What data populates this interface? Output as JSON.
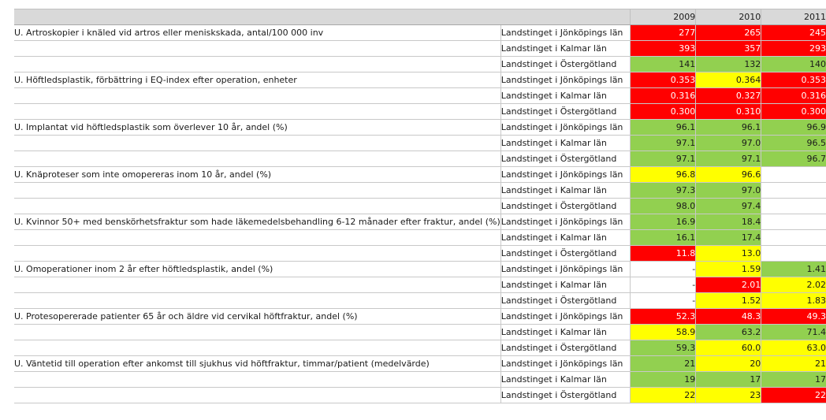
{
  "colors": {
    "red": "#ff0000",
    "yellow": "#ffff00",
    "green": "#92d050",
    "white": "#ffffff"
  },
  "years": [
    "2009",
    "2010",
    "2011"
  ],
  "indicators": [
    {
      "name": "U. Artroskopier i knäled vid artros eller meniskskada, antal/100 000 inv",
      "rows": [
        {
          "region": "Landstinget i Jönköpings län",
          "values": [
            {
              "v": "277",
              "c": "red"
            },
            {
              "v": "265",
              "c": "red"
            },
            {
              "v": "245",
              "c": "red"
            }
          ]
        },
        {
          "region": "Landstinget i Kalmar län",
          "values": [
            {
              "v": "393",
              "c": "red"
            },
            {
              "v": "357",
              "c": "red"
            },
            {
              "v": "293",
              "c": "red"
            }
          ]
        },
        {
          "region": "Landstinget i Östergötland",
          "values": [
            {
              "v": "141",
              "c": "green"
            },
            {
              "v": "132",
              "c": "green"
            },
            {
              "v": "140",
              "c": "green"
            }
          ]
        }
      ]
    },
    {
      "name": "U. Höftledsplastik, förbättring i EQ-index efter operation, enheter",
      "rows": [
        {
          "region": "Landstinget i Jönköpings län",
          "values": [
            {
              "v": "0.353",
              "c": "red"
            },
            {
              "v": "0.364",
              "c": "yellow"
            },
            {
              "v": "0.353",
              "c": "red"
            }
          ]
        },
        {
          "region": "Landstinget i Kalmar län",
          "values": [
            {
              "v": "0.316",
              "c": "red"
            },
            {
              "v": "0.327",
              "c": "red"
            },
            {
              "v": "0.316",
              "c": "red"
            }
          ]
        },
        {
          "region": "Landstinget i Östergötland",
          "values": [
            {
              "v": "0.300",
              "c": "red"
            },
            {
              "v": "0.310",
              "c": "red"
            },
            {
              "v": "0.300",
              "c": "red"
            }
          ]
        }
      ]
    },
    {
      "name": "U. Implantat vid höftledsplastik som överlever 10 år, andel (%)",
      "rows": [
        {
          "region": "Landstinget i Jönköpings län",
          "values": [
            {
              "v": "96.1",
              "c": "green"
            },
            {
              "v": "96.1",
              "c": "green"
            },
            {
              "v": "96.9",
              "c": "green"
            }
          ]
        },
        {
          "region": "Landstinget i Kalmar län",
          "values": [
            {
              "v": "97.1",
              "c": "green"
            },
            {
              "v": "97.0",
              "c": "green"
            },
            {
              "v": "96.5",
              "c": "green"
            }
          ]
        },
        {
          "region": "Landstinget i Östergötland",
          "values": [
            {
              "v": "97.1",
              "c": "green"
            },
            {
              "v": "97.1",
              "c": "green"
            },
            {
              "v": "96.7",
              "c": "green"
            }
          ]
        }
      ]
    },
    {
      "name": "U. Knäproteser som inte omopereras inom 10 år, andel (%)",
      "rows": [
        {
          "region": "Landstinget i Jönköpings län",
          "values": [
            {
              "v": "96.8",
              "c": "yellow"
            },
            {
              "v": "96.6",
              "c": "yellow"
            },
            {
              "v": "",
              "c": "white"
            }
          ]
        },
        {
          "region": "Landstinget i Kalmar län",
          "values": [
            {
              "v": "97.3",
              "c": "green"
            },
            {
              "v": "97.0",
              "c": "green"
            },
            {
              "v": "",
              "c": "white"
            }
          ]
        },
        {
          "region": "Landstinget i Östergötland",
          "values": [
            {
              "v": "98.0",
              "c": "green"
            },
            {
              "v": "97.4",
              "c": "green"
            },
            {
              "v": "",
              "c": "white"
            }
          ]
        }
      ]
    },
    {
      "name": "U. Kvinnor 50+ med benskörhetsfraktur som hade läkemedelsbehandling 6-12 månader efter fraktur, andel (%)",
      "rows": [
        {
          "region": "Landstinget i Jönköpings län",
          "values": [
            {
              "v": "16.9",
              "c": "green"
            },
            {
              "v": "18.4",
              "c": "green"
            },
            {
              "v": "",
              "c": "white"
            }
          ]
        },
        {
          "region": "Landstinget i Kalmar län",
          "values": [
            {
              "v": "16.1",
              "c": "green"
            },
            {
              "v": "17.4",
              "c": "green"
            },
            {
              "v": "",
              "c": "white"
            }
          ]
        },
        {
          "region": "Landstinget i Östergötland",
          "values": [
            {
              "v": "11.8",
              "c": "red"
            },
            {
              "v": "13.0",
              "c": "yellow"
            },
            {
              "v": "",
              "c": "white"
            }
          ]
        }
      ]
    },
    {
      "name": "U. Omoperationer inom 2 år efter höftledsplastik, andel (%)",
      "rows": [
        {
          "region": "Landstinget i Jönköpings län",
          "values": [
            {
              "v": "-",
              "c": "white"
            },
            {
              "v": "1.59",
              "c": "yellow"
            },
            {
              "v": "1.41",
              "c": "green"
            }
          ]
        },
        {
          "region": "Landstinget i Kalmar län",
          "values": [
            {
              "v": "-",
              "c": "white"
            },
            {
              "v": "2.01",
              "c": "red"
            },
            {
              "v": "2.02",
              "c": "yellow"
            }
          ]
        },
        {
          "region": "Landstinget i Östergötland",
          "values": [
            {
              "v": "-",
              "c": "white"
            },
            {
              "v": "1.52",
              "c": "yellow"
            },
            {
              "v": "1.83",
              "c": "yellow"
            }
          ]
        }
      ]
    },
    {
      "name": "U. Protesopererade patienter 65 år och äldre vid cervikal höftfraktur, andel (%)",
      "rows": [
        {
          "region": "Landstinget i Jönköpings län",
          "values": [
            {
              "v": "52.3",
              "c": "red"
            },
            {
              "v": "48.3",
              "c": "red"
            },
            {
              "v": "49.3",
              "c": "red"
            }
          ]
        },
        {
          "region": "Landstinget i Kalmar län",
          "values": [
            {
              "v": "58.9",
              "c": "yellow"
            },
            {
              "v": "63.2",
              "c": "green"
            },
            {
              "v": "71.4",
              "c": "green"
            }
          ]
        },
        {
          "region": "Landstinget i Östergötland",
          "values": [
            {
              "v": "59.3",
              "c": "green"
            },
            {
              "v": "60.0",
              "c": "yellow"
            },
            {
              "v": "63.0",
              "c": "yellow"
            }
          ]
        }
      ]
    },
    {
      "name": "U. Väntetid till operation efter ankomst till sjukhus vid höftfraktur, timmar/patient (medelvärde)",
      "rows": [
        {
          "region": "Landstinget i Jönköpings län",
          "values": [
            {
              "v": "21",
              "c": "green"
            },
            {
              "v": "20",
              "c": "yellow"
            },
            {
              "v": "21",
              "c": "yellow"
            }
          ]
        },
        {
          "region": "Landstinget i Kalmar län",
          "values": [
            {
              "v": "19",
              "c": "green"
            },
            {
              "v": "17",
              "c": "green"
            },
            {
              "v": "17",
              "c": "green"
            }
          ]
        },
        {
          "region": "Landstinget i Östergötland",
          "values": [
            {
              "v": "22",
              "c": "yellow"
            },
            {
              "v": "23",
              "c": "yellow"
            },
            {
              "v": "22",
              "c": "red"
            }
          ]
        }
      ]
    }
  ]
}
